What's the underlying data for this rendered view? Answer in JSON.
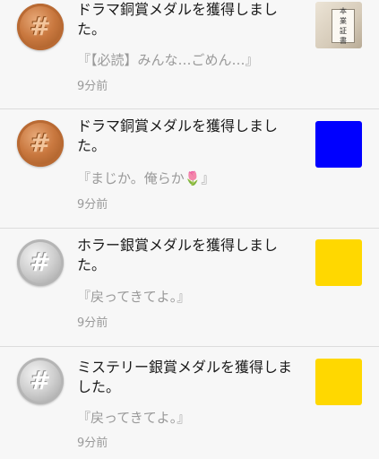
{
  "notifications": [
    {
      "medal": "bronze",
      "title": "ドラマ銅賞メダルを獲得しました。",
      "quote": "『【必読】みんな…ごめん…』",
      "time": "9分前",
      "thumb_kind": "book",
      "thumb_color": "#e0d6c4",
      "thumb_text": [
        "本",
        "業",
        "証",
        "書"
      ]
    },
    {
      "medal": "bronze",
      "title": "ドラマ銅賞メダルを獲得しました。",
      "quote": "『まじか。俺らか",
      "quote_emoji": "🌷",
      "quote_end": "』",
      "time": "9分前",
      "thumb_kind": "color",
      "thumb_color": "#0000ff"
    },
    {
      "medal": "silver",
      "title": "ホラー銀賞メダルを獲得しました。",
      "quote": "『戻ってきてよ。』",
      "time": "9分前",
      "thumb_kind": "color",
      "thumb_color": "#ffd800"
    },
    {
      "medal": "silver",
      "title": "ミステリー銀賞メダルを獲得しました。",
      "quote": "『戻ってきてよ。』",
      "time": "9分前",
      "thumb_kind": "color",
      "thumb_color": "#ffd800"
    }
  ],
  "icons": {
    "medal_glyph": "#"
  }
}
